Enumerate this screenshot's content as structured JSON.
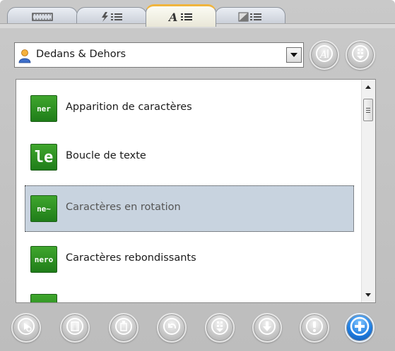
{
  "tabs": [
    {
      "icon": "film-strip-icon",
      "active": false
    },
    {
      "icon": "lightning-list-icon",
      "active": false
    },
    {
      "icon": "text-style-list-icon",
      "active": true
    },
    {
      "icon": "image-list-icon",
      "active": false
    }
  ],
  "combo": {
    "selected_value": "Dedans & Dehors",
    "icon": "person-icon"
  },
  "top_buttons": [
    {
      "icon": "text-a-icon"
    },
    {
      "icon": "download-grid-icon"
    }
  ],
  "list": {
    "items": [
      {
        "label": "Apparition de caractères",
        "thumb_text": "ner",
        "selected": false
      },
      {
        "label": "Boucle de texte",
        "thumb_text": "le",
        "selected": false
      },
      {
        "label": "Caractères en rotation",
        "thumb_text": "ne~",
        "selected": true
      },
      {
        "label": "Caractères rebondissants",
        "thumb_text": "nero",
        "selected": false
      },
      {
        "label": "",
        "thumb_text": "",
        "selected": false
      }
    ]
  },
  "toolbar": [
    {
      "icon": "preview-icon"
    },
    {
      "icon": "film-icon"
    },
    {
      "icon": "clip-icon"
    },
    {
      "icon": "undo-icon"
    },
    {
      "icon": "download-grid-icon"
    },
    {
      "icon": "download-arrow-icon"
    },
    {
      "icon": "alert-icon"
    },
    {
      "icon": "add-icon"
    }
  ],
  "colors": {
    "accent_tab": "#f0b43c",
    "thumb_green": "#2e9424",
    "selected_row": "#c8d3df",
    "add_button": "#1e7de0"
  }
}
